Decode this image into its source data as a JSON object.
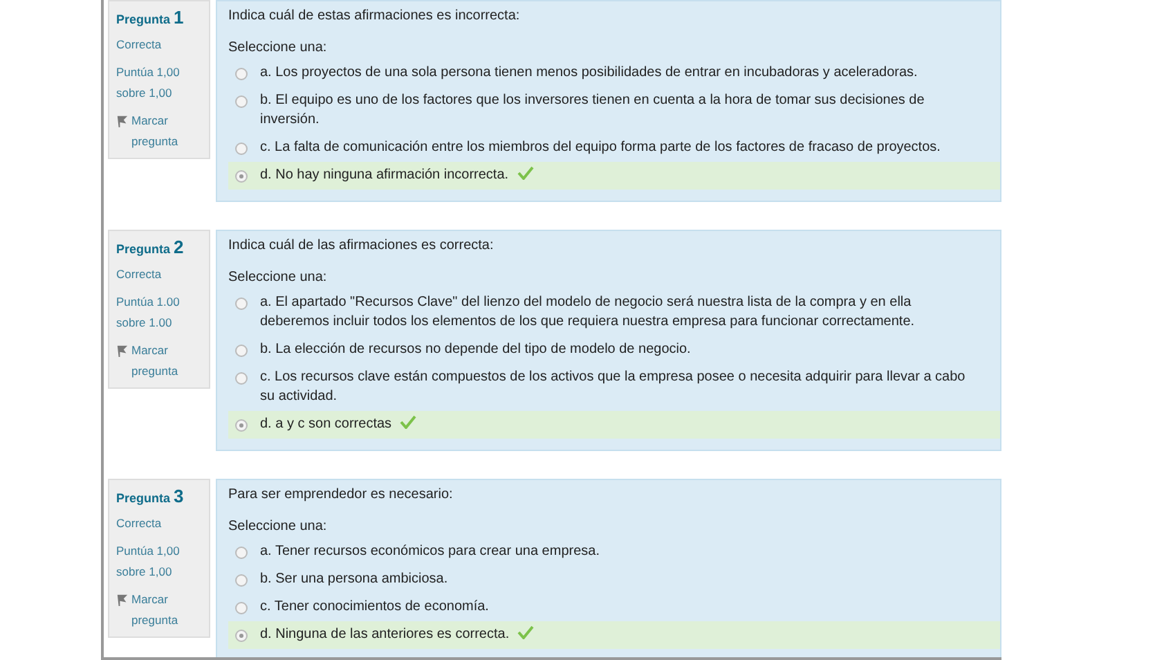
{
  "questions": [
    {
      "label": "Pregunta",
      "number": "1",
      "status": "Correcta",
      "score": "Puntúa 1,00 sobre 1,00",
      "flag": "Marcar pregunta",
      "prompt": "Indica cuál de estas afirmaciones es incorrecta:",
      "instruction": "Seleccione una:",
      "options": [
        {
          "letter": "a.",
          "text": "Los proyectos de una sola persona tienen menos posibilidades de entrar en incubadoras y aceleradoras.",
          "selected": false
        },
        {
          "letter": "b.",
          "text": "El equipo es uno de los factores que los inversores tienen en cuenta a la hora de tomar sus decisiones de inversión.",
          "selected": false
        },
        {
          "letter": "c.",
          "text": "La falta de comunicación entre los miembros del equipo forma parte de los factores de fracaso de proyectos.",
          "selected": false
        },
        {
          "letter": "d.",
          "text": "No hay ninguna afirmación incorrecta.",
          "selected": true
        }
      ]
    },
    {
      "label": "Pregunta",
      "number": "2",
      "status": "Correcta",
      "score": "Puntúa 1.00 sobre 1.00",
      "flag": "Marcar pregunta",
      "prompt": "Indica cuál de las afirmaciones es correcta:",
      "instruction": "Seleccione una:",
      "options": [
        {
          "letter": "a.",
          "text": "El apartado \"Recursos Clave\" del lienzo del modelo de negocio será nuestra lista de la compra y en ella deberemos incluir todos los elementos de los que requiera nuestra empresa para funcionar correctamente.",
          "selected": false
        },
        {
          "letter": "b.",
          "text": "La elección de recursos no depende del tipo de modelo de negocio.",
          "selected": false
        },
        {
          "letter": "c.",
          "text": "Los recursos clave están compuestos de los activos que la empresa posee o necesita adquirir para llevar a cabo su actividad.",
          "selected": false
        },
        {
          "letter": "d.",
          "text": "a y c son correctas",
          "selected": true
        }
      ]
    },
    {
      "label": "Pregunta",
      "number": "3",
      "status": "Correcta",
      "score": "Puntúa 1,00 sobre 1,00",
      "flag": "Marcar pregunta",
      "prompt": "Para ser emprendedor es necesario:",
      "instruction": "Seleccione una:",
      "options": [
        {
          "letter": "a.",
          "text": "Tener recursos económicos para crear una empresa.",
          "selected": false
        },
        {
          "letter": "b.",
          "text": "Ser una persona ambiciosa.",
          "selected": false
        },
        {
          "letter": "c.",
          "text": "Tener conocimientos de economía.",
          "selected": false
        },
        {
          "letter": "d.",
          "text": "Ninguna de las anteriores es correcta.",
          "selected": true
        }
      ]
    }
  ]
}
